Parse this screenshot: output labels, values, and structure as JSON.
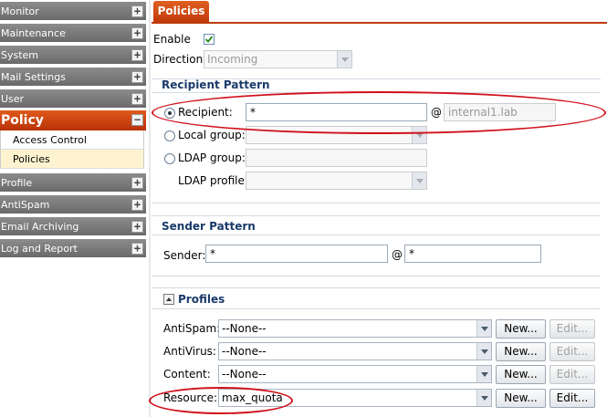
{
  "sidebar": {
    "items": [
      {
        "label": "Monitor",
        "toggle": "+"
      },
      {
        "label": "Maintenance",
        "toggle": "+"
      },
      {
        "label": "System",
        "toggle": "+"
      },
      {
        "label": "Mail Settings",
        "toggle": "+"
      },
      {
        "label": "User",
        "toggle": "+"
      }
    ],
    "active": {
      "label": "Policy",
      "toggle": "−"
    },
    "sub_items": [
      {
        "label": "Access Control"
      },
      {
        "label": "Policies"
      }
    ],
    "items_after": [
      {
        "label": "Profile",
        "toggle": "+"
      },
      {
        "label": "AntiSpam",
        "toggle": "+"
      },
      {
        "label": "Email Archiving",
        "toggle": "+"
      },
      {
        "label": "Log and Report",
        "toggle": "+"
      }
    ]
  },
  "tab": {
    "label": "Policies"
  },
  "general": {
    "enable_label": "Enable",
    "enable_checked": true,
    "direction_label": "Direction:",
    "direction_value": "Incoming"
  },
  "recipient": {
    "title": "Recipient Pattern",
    "recipient_label": "Recipient:",
    "recipient_value": "*",
    "at": "@",
    "domain_value": "internal1.lab",
    "local_group_label": "Local group:",
    "ldap_group_label": "LDAP group:",
    "ldap_profile_label": "LDAP profile:"
  },
  "sender": {
    "title": "Sender Pattern",
    "sender_label": "Sender:",
    "sender_value": "*",
    "at": "@",
    "domain_value": "*"
  },
  "profiles": {
    "title": "Profiles",
    "rows": [
      {
        "label": "AntiSpam:",
        "value": "--None--",
        "new": "New...",
        "edit": "Edit..."
      },
      {
        "label": "AntiVirus:",
        "value": "--None--",
        "new": "New...",
        "edit": "Edit..."
      },
      {
        "label": "Content:",
        "value": "--None--",
        "new": "New...",
        "edit": "Edit..."
      },
      {
        "label": "Resource:",
        "value": "max_quota",
        "new": "New...",
        "edit": "Edit..."
      }
    ]
  },
  "colors": {
    "accent": "#c8400e",
    "highlight_ellipse": "#d0101a",
    "section_title": "#1a3a6a"
  }
}
